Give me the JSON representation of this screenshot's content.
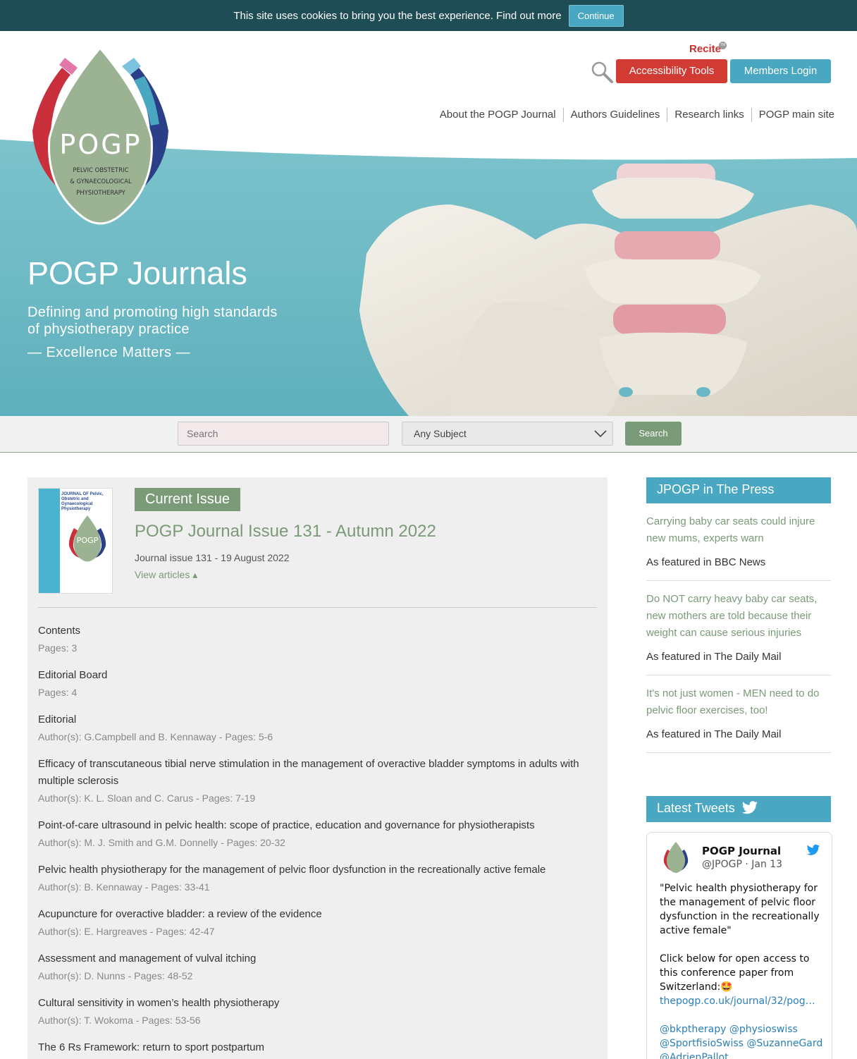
{
  "cookie": {
    "text": "This site uses cookies to bring you the best experience. Find out more",
    "button": "Continue"
  },
  "header": {
    "recite": "Recite",
    "recite_mark": "TM",
    "accessibility_button": "Accessibility Tools",
    "members_button": "Members Login",
    "nav": [
      "About the POGP Journal",
      "Authors Guidelines",
      "Research links",
      "POGP main site"
    ]
  },
  "logo": {
    "name": "POGP",
    "line1": "PELVIC OBSTETRIC",
    "line2": "& GYNAECOLOGICAL",
    "line3": "PHYSIOTHERAPY"
  },
  "hero": {
    "title": "POGP Journals",
    "subtitle": "Defining and promoting high standards of physiotherapy practice",
    "tagline": "— Excellence Matters —"
  },
  "search": {
    "placeholder": "Search",
    "subject": "Any Subject",
    "button": "Search"
  },
  "issue": {
    "cover_title": "JOURNAL OF Pelvic, Obstetric and Gynaecological Physiotherapy",
    "cover_logo": "POGP",
    "badge": "Current Issue",
    "title": "POGP Journal Issue 131 - Autumn 2022",
    "date": "Journal issue 131 - 19 August 2022",
    "view_articles": "View articles ▴"
  },
  "articles": [
    {
      "title": "Contents",
      "meta": "Pages: 3"
    },
    {
      "title": "Editorial Board",
      "meta": "Pages: 4"
    },
    {
      "title": "Editorial",
      "meta": "Author(s): G.Campbell and B. Kennaway - Pages: 5-6"
    },
    {
      "title": "Efficacy of transcutaneous tibial nerve stimulation in the management of overactive bladder symptoms in adults with multiple sclerosis",
      "meta": "Author(s): K. L. Sloan and C. Carus - Pages: 7-19"
    },
    {
      "title": "Point-of-care ultrasound in pelvic health: scope of practice, education and governance for physiotherapists",
      "meta": "Author(s): M. J. Smith and G.M. Donnelly - Pages: 20-32"
    },
    {
      "title": "Pelvic health physiotherapy for the management of pelvic floor dysfunction in the recreationally active female",
      "meta": "Author(s): B. Kennaway - Pages: 33-41"
    },
    {
      "title": "Acupuncture for overactive bladder: a review of the evidence",
      "meta": "Author(s): E. Hargreaves - Pages: 42-47"
    },
    {
      "title": "Assessment and management of vulval itching",
      "meta": "Author(s): D. Nunns - Pages: 48-52"
    },
    {
      "title": "Cultural sensitivity in women’s health physiotherapy",
      "meta": "Author(s): T. Wokoma - Pages: 53-56"
    },
    {
      "title": "The 6 Rs Framework: return to sport postpartum",
      "meta": ""
    }
  ],
  "press": {
    "heading": "JPOGP in The Press",
    "items": [
      {
        "link": "Carrying baby car seats could injure new mums, experts warn",
        "source": "As featured in BBC News"
      },
      {
        "link": "Do NOT carry heavy baby car seats, new mothers are told because their weight can cause serious injuries",
        "source": "As featured in The Daily Mail"
      },
      {
        "link": "It's not just women - MEN need to do pelvic floor exercises, too!",
        "source": "As featured in The Daily Mail"
      }
    ]
  },
  "tweets": {
    "heading": "Latest Tweets",
    "name": "POGP Journal",
    "handle": "@JPOGP · Jan 13",
    "quote": "\"Pelvic health physiotherapy for the management of pelvic floor dysfunction in the recreationally active female\"",
    "body": "Click below for open access to this conference paper from Switzerland:🤩",
    "link": "thepogp.co.uk/journal/32/pog…",
    "mentions": "@bkptherapy @physioswiss @SportfisioSwiss @SuzanneGard @AdrienPallot"
  },
  "colors": {
    "teal": "#4aa7c1",
    "green": "#7a9a78",
    "red": "#d23a34",
    "dark": "#1f4d55"
  }
}
